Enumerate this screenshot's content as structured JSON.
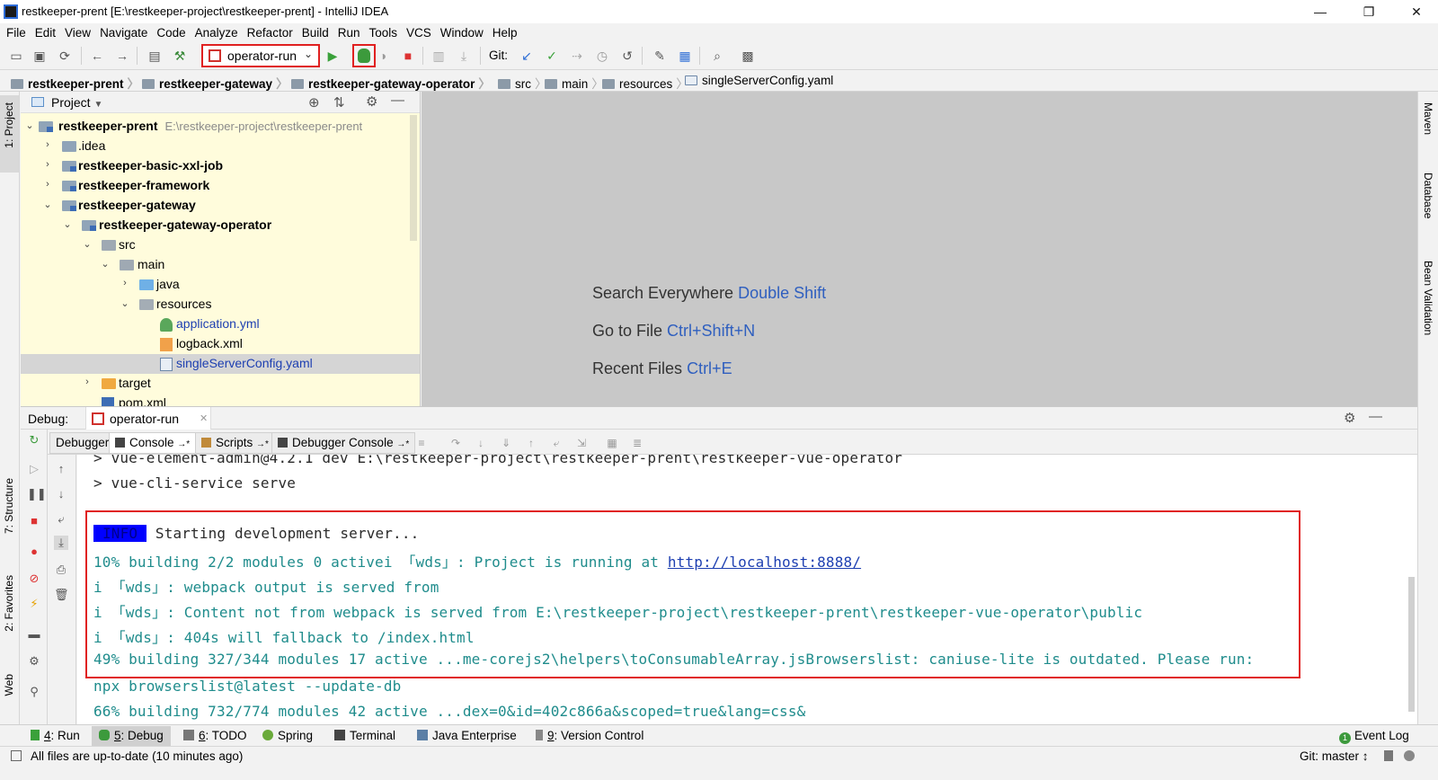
{
  "window": {
    "title": "restkeeper-prent [E:\\restkeeper-project\\restkeeper-prent] - IntelliJ IDEA",
    "minimize": "—",
    "restore": "❐",
    "close": "✕"
  },
  "menu": [
    "File",
    "Edit",
    "View",
    "Navigate",
    "Code",
    "Analyze",
    "Refactor",
    "Build",
    "Run",
    "Tools",
    "VCS",
    "Window",
    "Help"
  ],
  "toolbar": {
    "run_config": "operator-run",
    "git_label": "Git:"
  },
  "breadcrumb": [
    {
      "label": "restkeeper-prent",
      "bold": true
    },
    {
      "label": "restkeeper-gateway",
      "bold": true
    },
    {
      "label": "restkeeper-gateway-operator",
      "bold": true
    },
    {
      "label": "src",
      "bold": false
    },
    {
      "label": "main",
      "bold": false
    },
    {
      "label": "resources",
      "bold": false
    },
    {
      "label": "singleServerConfig.yaml",
      "bold": false
    }
  ],
  "left_tabs": {
    "project": "1: Project",
    "structure": "7: Structure",
    "favorites": "2: Favorites",
    "web": "Web"
  },
  "right_tabs": {
    "maven": "Maven",
    "database": "Database",
    "bean_validation": "Bean Validation"
  },
  "project_panel": {
    "title": "Project",
    "root_path": "E:\\restkeeper-project\\restkeeper-prent",
    "tree": [
      {
        "label": "restkeeper-prent",
        "bold": true
      },
      {
        "label": ".idea",
        "bold": false
      },
      {
        "label": "restkeeper-basic-xxl-job",
        "bold": true
      },
      {
        "label": "restkeeper-framework",
        "bold": true
      },
      {
        "label": "restkeeper-gateway",
        "bold": true
      },
      {
        "label": "restkeeper-gateway-operator",
        "bold": true
      },
      {
        "label": "src",
        "bold": false
      },
      {
        "label": "main",
        "bold": false
      },
      {
        "label": "java",
        "bold": false
      },
      {
        "label": "resources",
        "bold": false
      },
      {
        "label": "application.yml",
        "bold": false
      },
      {
        "label": "logback.xml",
        "bold": false
      },
      {
        "label": "singleServerConfig.yaml",
        "bold": false
      },
      {
        "label": "target",
        "bold": false
      },
      {
        "label": "pom.xml",
        "bold": false
      }
    ]
  },
  "editor_hints": [
    {
      "text": "Search Everywhere",
      "shortcut": "Double Shift"
    },
    {
      "text": "Go to File",
      "shortcut": "Ctrl+Shift+N"
    },
    {
      "text": "Recent Files",
      "shortcut": "Ctrl+E"
    }
  ],
  "debug": {
    "label": "Debug:",
    "tab": "operator-run",
    "subtabs": [
      "Debugger",
      "Console",
      "Scripts",
      "Debugger Console"
    ]
  },
  "console": {
    "line1": "> vue-element-admin@4.2.1 dev E:\\restkeeper-project\\restkeeper-prent\\restkeeper-vue-operator",
    "line2": "> vue-cli-service serve",
    "info_badge": "INFO",
    "line3": " Starting development server...",
    "line4_pre": " 10% building 2/2 modules 0 activei 「wds」: Project is running at ",
    "line4_link": "http://localhost:8888/",
    "line5": "i 「wds」: webpack output is served from",
    "line6": "i 「wds」: Content not from webpack is served from E:\\restkeeper-project\\restkeeper-prent\\restkeeper-vue-operator\\public",
    "line7": "i 「wds」: 404s will fallback to /index.html",
    "line8": " 49% building 327/344 modules 17 active ...me-corejs2\\helpers\\toConsumableArray.jsBrowserslist: caniuse-lite is outdated. Please run:",
    "line9": "npx browserslist@latest --update-db",
    "line10": " 66% building 732/774 modules 42 active ...dex=0&id=402c866a&scoped=true&lang=css&"
  },
  "tool_windows": [
    {
      "num": "4",
      "label": ": Run"
    },
    {
      "num": "5",
      "label": ": Debug"
    },
    {
      "num": "6",
      "label": ": TODO"
    },
    {
      "num": "",
      "label": "Spring"
    },
    {
      "num": "",
      "label": "Terminal"
    },
    {
      "num": "",
      "label": "Java Enterprise"
    },
    {
      "num": "9",
      "label": ": Version Control"
    }
  ],
  "event_log": {
    "count": "1",
    "label": "Event Log"
  },
  "status": {
    "message": "All files are up-to-date (10 minutes ago)",
    "git_branch": "Git: master ↕"
  }
}
